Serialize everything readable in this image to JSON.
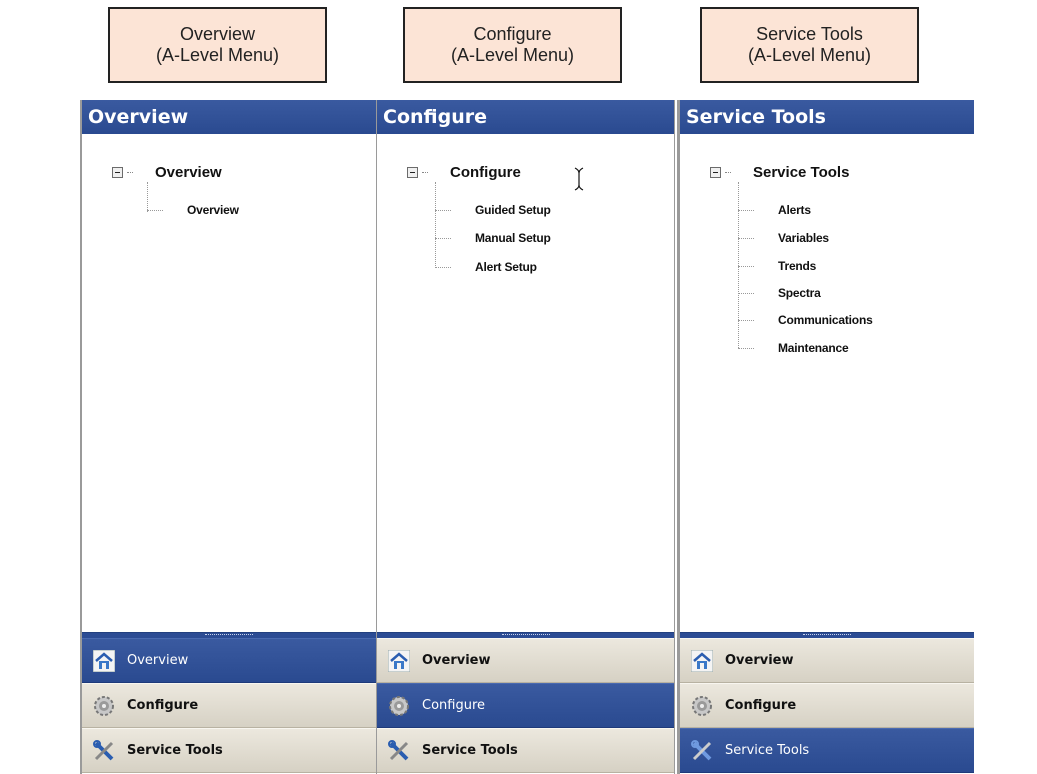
{
  "captions": [
    {
      "line1": "Overview",
      "line2": "(A-Level Menu)"
    },
    {
      "line1": "Configure",
      "line2": "(A-Level Menu)"
    },
    {
      "line1": "Service Tools",
      "line2": "(A-Level Menu)"
    }
  ],
  "panels": [
    {
      "title": "Overview",
      "tree_root": "Overview",
      "children": [
        "Overview"
      ],
      "active_nav": "Overview"
    },
    {
      "title": "Configure",
      "tree_root": "Configure",
      "children": [
        "Guided Setup",
        "Manual Setup",
        "Alert Setup"
      ],
      "active_nav": "Configure"
    },
    {
      "title": "Service Tools",
      "tree_root": "Service Tools",
      "children": [
        "Alerts",
        "Variables",
        "Trends",
        "Spectra",
        "Communications",
        "Maintenance"
      ],
      "active_nav": "Service Tools"
    }
  ],
  "nav": {
    "overview": "Overview",
    "configure": "Configure",
    "service_tools": "Service Tools"
  },
  "icons": {
    "overview": "home-icon",
    "configure": "gear-icon",
    "service_tools": "tools-icon"
  },
  "colors": {
    "accent_blue": "#2a4a90",
    "nav_beige": "#e0dccf",
    "caption_bg": "#fce4d6"
  }
}
